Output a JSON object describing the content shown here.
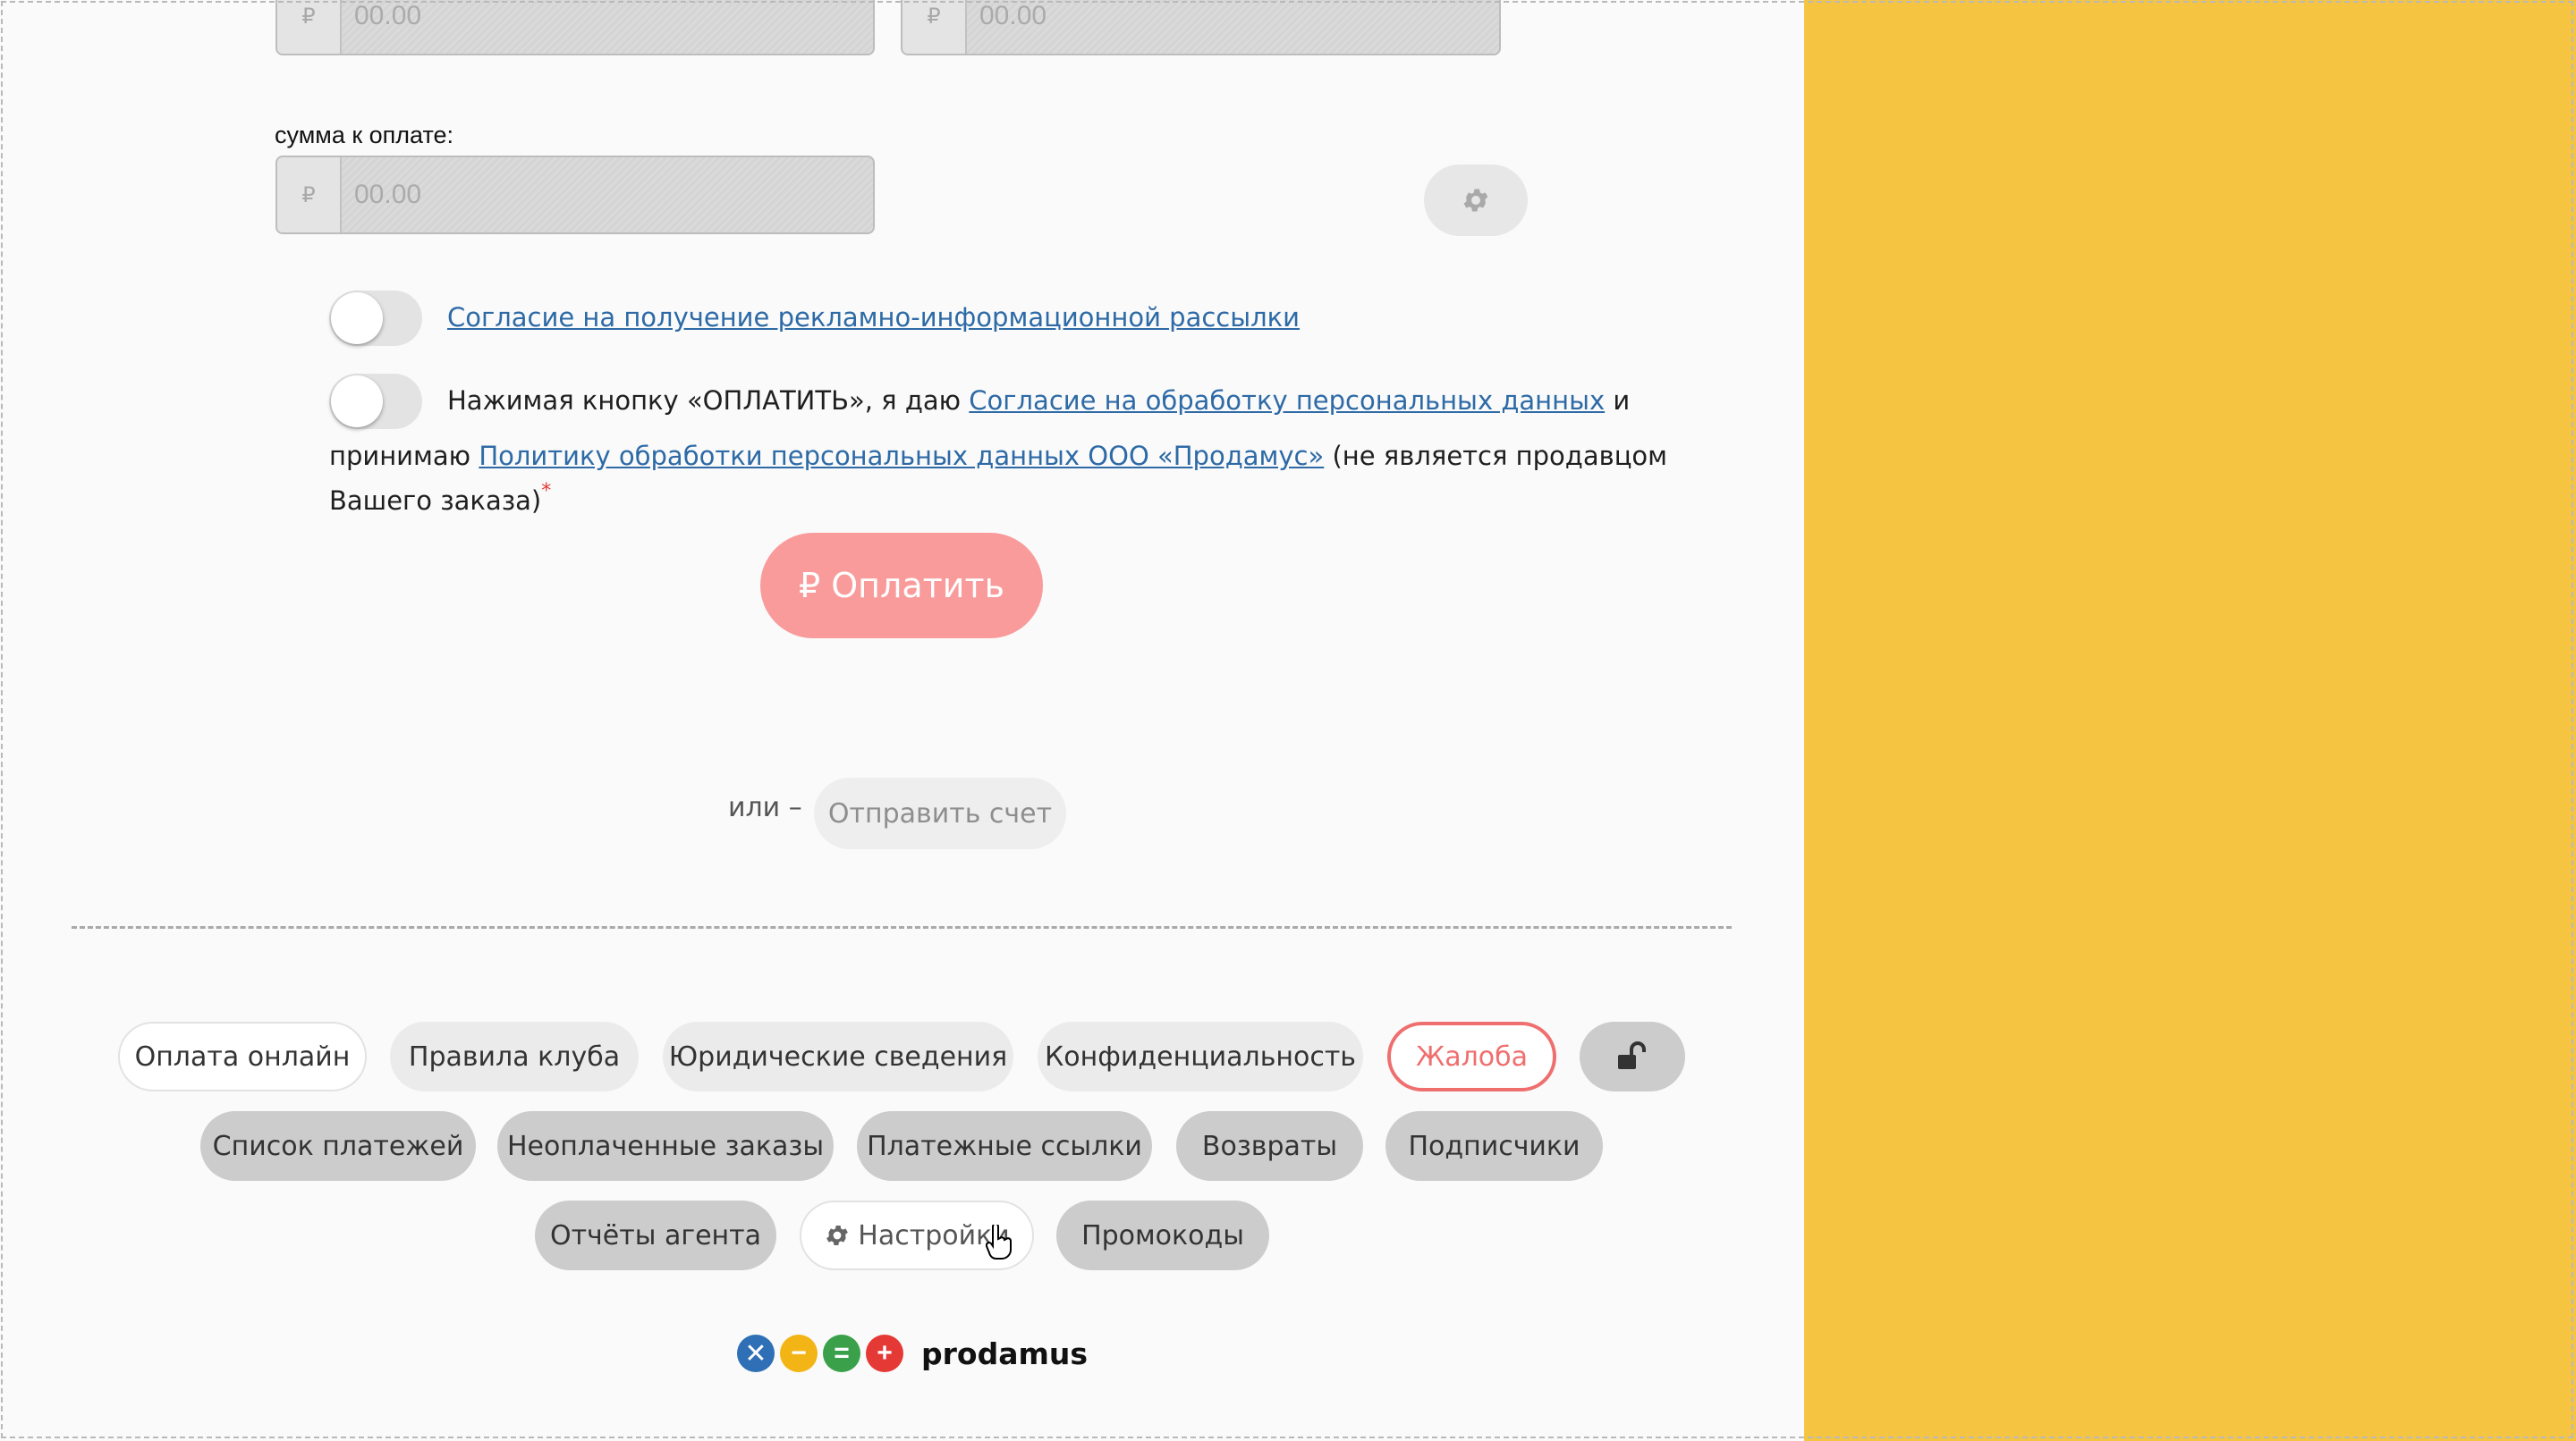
{
  "form": {
    "currency_symbol": "₽",
    "top_field_left_placeholder": "00.00",
    "top_field_right_placeholder": "00.00",
    "amount_label": "сумма к оплате:",
    "amount_placeholder": "00.00"
  },
  "consent": {
    "newsletter_link": "Согласие на получение рекламно-информационной рассылки",
    "personal_prefix": "Нажимая кнопку «ОПЛАТИТЬ», я даю ",
    "personal_link": "Согласие на обработку персональных данных",
    "personal_and": " и",
    "accept_prefix": "принимаю ",
    "policy_link": "Политику обработки персональных данных ООО «Продамус»",
    "policy_suffix": " (не является продавцом",
    "policy_line3": "Вашего заказа)",
    "required_mark": "*"
  },
  "pay_button": "₽ Оплатить",
  "or_label": "или –",
  "send_invoice_button": "Отправить счет",
  "footer": {
    "row1": [
      "Оплата онлайн",
      "Правила клуба",
      "Юридические сведения",
      "Конфиденциальность",
      "Жалоба"
    ],
    "row2": [
      "Список платежей",
      "Неоплаченные заказы",
      "Платежные ссылки",
      "Возвраты",
      "Подписчики"
    ],
    "row3": [
      "Отчёты агента",
      "Настройки",
      "Промокоды"
    ],
    "lock_icon": "lock-open-icon",
    "settings_icon": "gear-icon"
  },
  "logo": {
    "name": "prodamus",
    "circle_colors": [
      "#2f6fb5",
      "#f3b515",
      "#3aa04a",
      "#e53935"
    ],
    "circle_symbols": [
      "✕",
      "−",
      "=",
      "+"
    ]
  },
  "colors": {
    "sidebar": "#f5c542",
    "pay_button": "#f99b9b",
    "link": "#2d6aa6",
    "complaint": "#ef6f6f"
  }
}
